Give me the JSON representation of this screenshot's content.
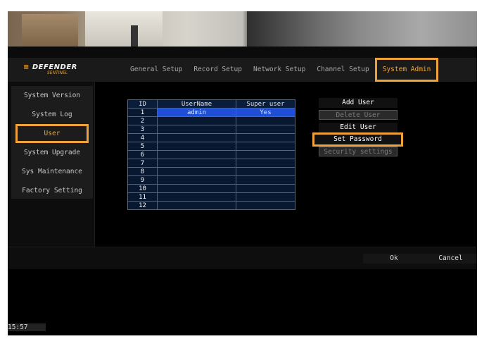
{
  "header": {
    "logo_text": "DEFENDER",
    "logo_mark": "≡",
    "logo_subtext": "SENTINEL",
    "tabs": [
      {
        "label": "General Setup",
        "active": false
      },
      {
        "label": "Record Setup",
        "active": false
      },
      {
        "label": "Network Setup",
        "active": false
      },
      {
        "label": "Channel Setup",
        "active": false
      },
      {
        "label": "System Admin",
        "active": true
      }
    ]
  },
  "sidebar": {
    "items": [
      {
        "label": "System Version",
        "active": false
      },
      {
        "label": "System Log",
        "active": false
      },
      {
        "label": "User",
        "active": true
      },
      {
        "label": "System Upgrade",
        "active": false
      },
      {
        "label": "Sys Maintenance",
        "active": false
      },
      {
        "label": "Factory Setting",
        "active": false
      }
    ]
  },
  "user_table": {
    "headers": {
      "id": "ID",
      "username": "UserName",
      "super_user": "Super user"
    },
    "rows": [
      {
        "id": "1",
        "username": "admin",
        "super_user": "Yes",
        "selected": true
      },
      {
        "id": "2",
        "username": "",
        "super_user": ""
      },
      {
        "id": "3",
        "username": "",
        "super_user": ""
      },
      {
        "id": "4",
        "username": "",
        "super_user": ""
      },
      {
        "id": "5",
        "username": "",
        "super_user": ""
      },
      {
        "id": "6",
        "username": "",
        "super_user": ""
      },
      {
        "id": "7",
        "username": "",
        "super_user": ""
      },
      {
        "id": "8",
        "username": "",
        "super_user": ""
      },
      {
        "id": "9",
        "username": "",
        "super_user": ""
      },
      {
        "id": "10",
        "username": "",
        "super_user": ""
      },
      {
        "id": "11",
        "username": "",
        "super_user": ""
      },
      {
        "id": "12",
        "username": "",
        "super_user": ""
      }
    ]
  },
  "actions": {
    "add_user": "Add User",
    "delete_user": "Delete User",
    "edit_user": "Edit User",
    "set_password": "Set Password",
    "security_settings": "Security settings"
  },
  "footer": {
    "ok": "Ok",
    "cancel": "Cancel"
  },
  "clock": "15:57",
  "colors": {
    "highlight": "#f0a23a",
    "selected_row": "#1e4fd6",
    "table_border": "#3c6aa8"
  }
}
